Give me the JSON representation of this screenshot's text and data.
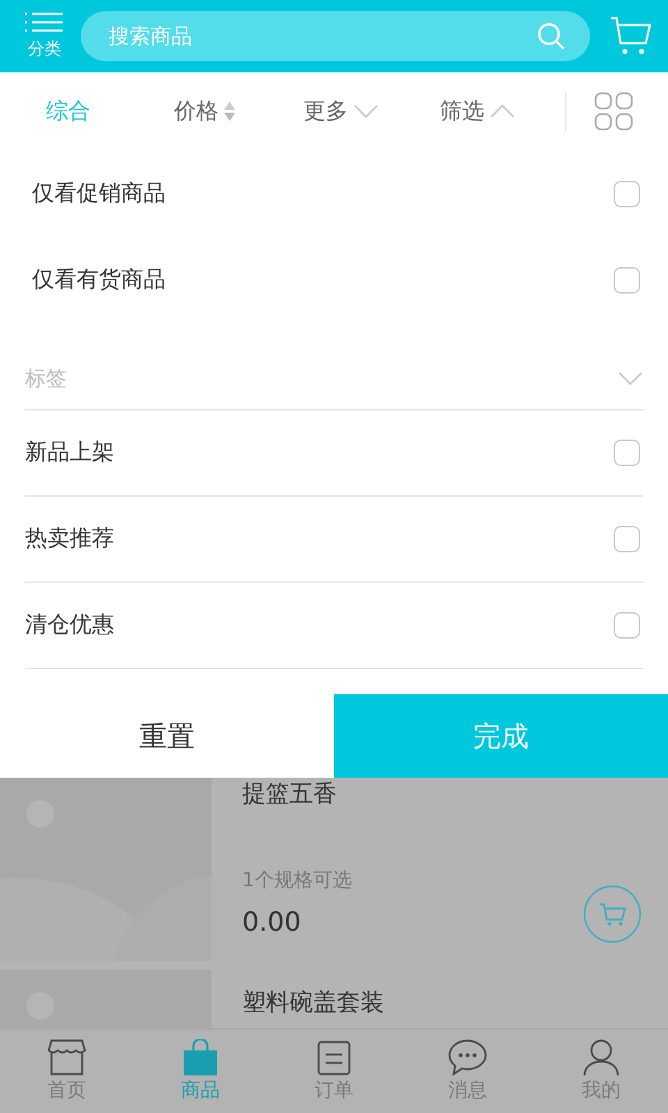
{
  "header": {
    "category_label": "分类",
    "search": {
      "placeholder": "搜索商品"
    }
  },
  "sort_tabs": [
    {
      "label": "综合",
      "selected": true,
      "kind": "plain"
    },
    {
      "label": "价格",
      "selected": false,
      "kind": "sort"
    },
    {
      "label": "更多",
      "selected": false,
      "kind": "dropdown"
    },
    {
      "label": "筛选",
      "selected": false,
      "kind": "dropup"
    }
  ],
  "filter": {
    "options": [
      {
        "label": "仅看促销商品",
        "checked": false
      },
      {
        "label": "仅看有货商品",
        "checked": false
      }
    ],
    "tag_group": {
      "title": "标签",
      "options": [
        {
          "label": "新品上架",
          "checked": false
        },
        {
          "label": "热卖推荐",
          "checked": false
        },
        {
          "label": "清仓优惠",
          "checked": false
        }
      ]
    },
    "reset_button": "重置",
    "done_button": "完成"
  },
  "products": [
    {
      "title": "提篮五香",
      "spec": "1个规格可选",
      "price": "0.00"
    },
    {
      "title": "塑料碗盖套装"
    }
  ],
  "tab_bar": [
    {
      "label": "首页",
      "selected": false,
      "kind": "store"
    },
    {
      "label": "商品",
      "selected": true,
      "kind": "bag"
    },
    {
      "label": "订单",
      "selected": false,
      "kind": "list"
    },
    {
      "label": "消息",
      "selected": false,
      "kind": "chat"
    },
    {
      "label": "我的",
      "selected": false,
      "kind": "person"
    }
  ]
}
